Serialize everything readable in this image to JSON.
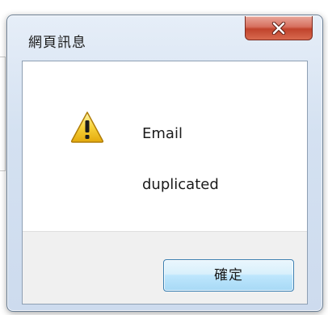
{
  "dialog": {
    "title": "網頁訊息",
    "close_icon": "close-x-icon",
    "message_icon": "warning-icon",
    "message_lines": [
      "Email",
      "duplicated"
    ],
    "ok_label": "確定"
  },
  "colors": {
    "close_button": "#c9503a",
    "ok_button_border": "#3c7fb1",
    "footer_background": "#f0f0f0",
    "warning_yellow": "#f5c518"
  }
}
